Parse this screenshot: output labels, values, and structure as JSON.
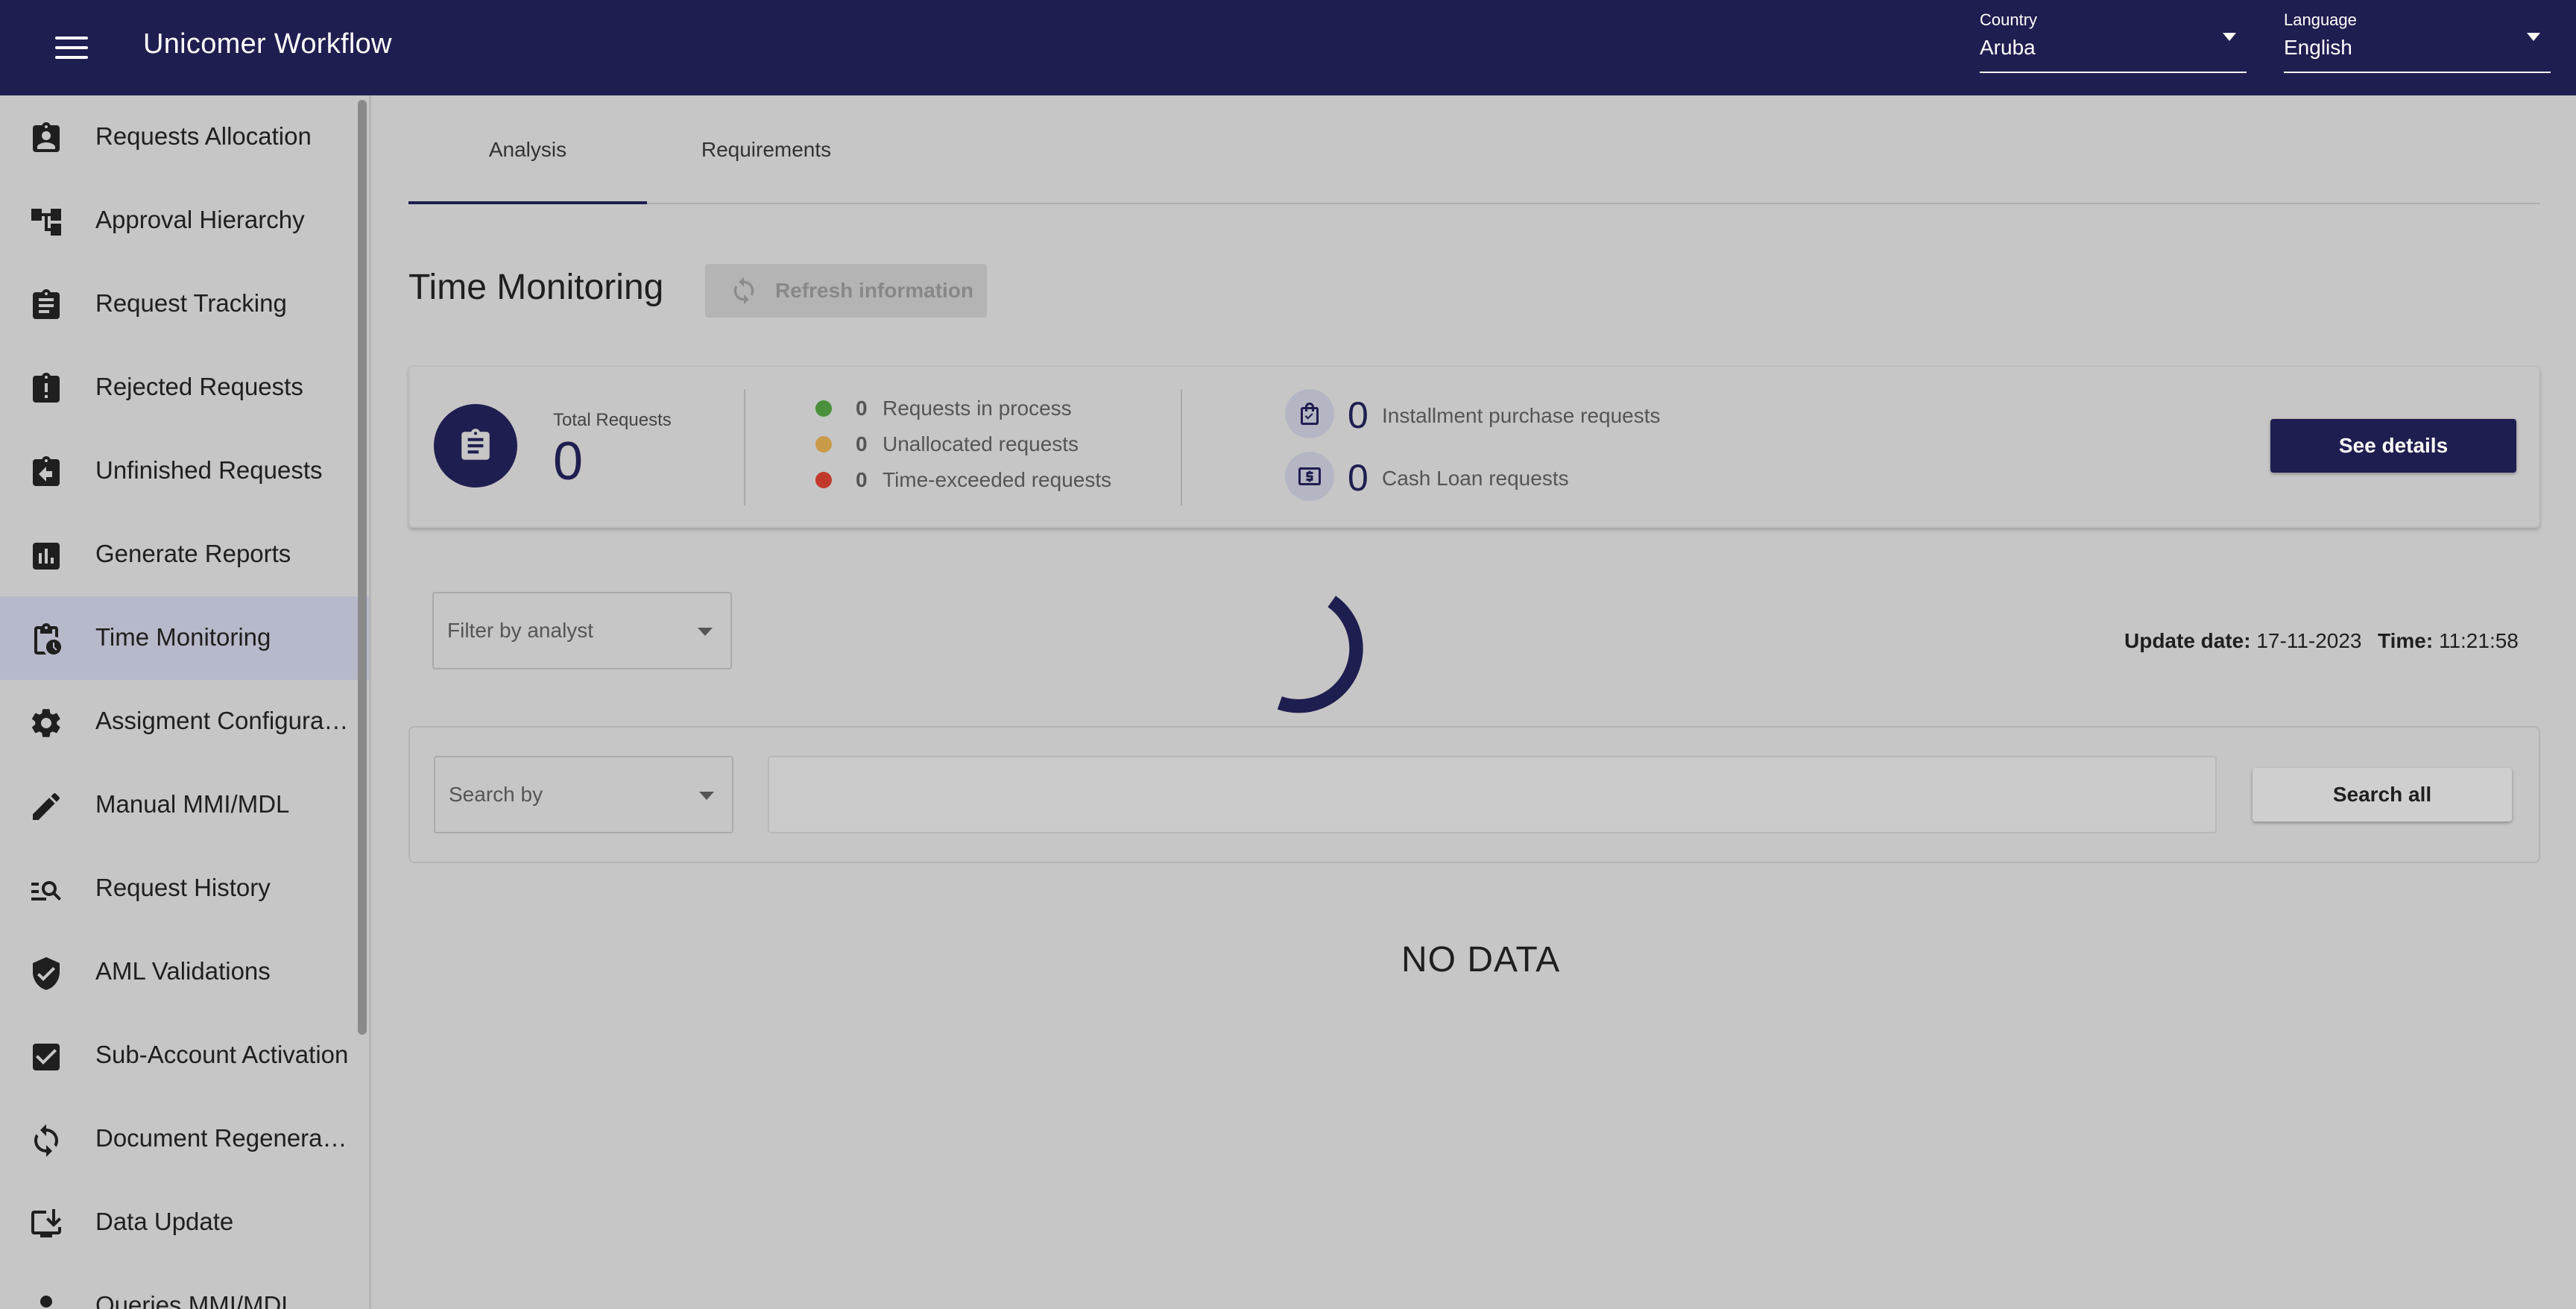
{
  "app": {
    "title": "Unicomer Workflow"
  },
  "header": {
    "country": {
      "label": "Country",
      "value": "Aruba"
    },
    "language": {
      "label": "Language",
      "value": "English"
    }
  },
  "sidebar": {
    "items": [
      {
        "label": "Requests Allocation",
        "icon": "assignment-ind-icon"
      },
      {
        "label": "Approval Hierarchy",
        "icon": "hierarchy-icon"
      },
      {
        "label": "Request Tracking",
        "icon": "assignment-icon"
      },
      {
        "label": "Rejected Requests",
        "icon": "assignment-late-icon"
      },
      {
        "label": "Unfinished Requests",
        "icon": "assignment-return-icon"
      },
      {
        "label": "Generate Reports",
        "icon": "bar-chart-icon"
      },
      {
        "label": "Time Monitoring",
        "icon": "pending-actions-icon",
        "active": true
      },
      {
        "label": "Assigment Configurati...",
        "icon": "gear-icon"
      },
      {
        "label": "Manual MMI/MDL",
        "icon": "pencil-icon"
      },
      {
        "label": "Request History",
        "icon": "manage-search-icon"
      },
      {
        "label": "AML Validations",
        "icon": "verified-shield-icon"
      },
      {
        "label": "Sub-Account Activation",
        "icon": "checkbox-icon"
      },
      {
        "label": "Document Regenerati...",
        "icon": "sync-icon"
      },
      {
        "label": "Data Update",
        "icon": "install-desktop-icon"
      },
      {
        "label": "Queries MMI/MDL",
        "icon": "person-icon"
      }
    ]
  },
  "tabs": [
    {
      "label": "Analysis",
      "active": true
    },
    {
      "label": "Requirements",
      "active": false
    }
  ],
  "page": {
    "title": "Time Monitoring",
    "refresh_label": "Refresh information"
  },
  "summary": {
    "total_label": "Total Requests",
    "total_value": "0",
    "statuses": [
      {
        "count": "0",
        "label": "Requests in process",
        "color": "#4a8f3a"
      },
      {
        "count": "0",
        "label": "Unallocated requests",
        "color": "#c99a4a"
      },
      {
        "count": "0",
        "label": "Time-exceeded requests",
        "color": "#c0392b"
      }
    ],
    "types": [
      {
        "count": "0",
        "label": "Installment purchase requests",
        "icon": "shopping-bag-icon"
      },
      {
        "count": "0",
        "label": "Cash Loan requests",
        "icon": "cash-icon"
      }
    ],
    "details_label": "See details"
  },
  "filter": {
    "analyst_placeholder": "Filter by analyst",
    "update_date_label": "Update date:",
    "update_date_value": "17-11-2023",
    "time_label": "Time:",
    "time_value": "11:21:58"
  },
  "search": {
    "search_by_placeholder": "Search by",
    "input_value": "",
    "search_all_label": "Search all"
  },
  "empty_state": "NO DATA",
  "colors": {
    "primary": "#1f1e50",
    "background": "#c6c6c6"
  }
}
